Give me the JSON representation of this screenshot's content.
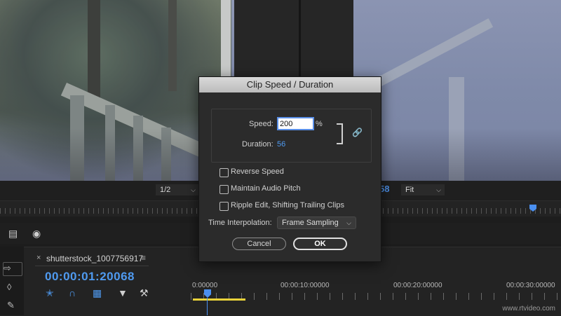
{
  "monitor": {
    "resolution": "1/2",
    "fit": "Fit",
    "timecode_partial": "58"
  },
  "sequence": {
    "tab_close": "×",
    "name": "shutterstock_1007756917",
    "menu_icon": "≡",
    "timecode": "00:00:01:20068",
    "ruler_labels": [
      "0:00000",
      "00:00:10:00000",
      "00:00:20:00000",
      "00:00:30:00000"
    ]
  },
  "dialog": {
    "title": "Clip Speed / Duration",
    "speed_label": "Speed:",
    "speed_value": "200",
    "speed_unit": "%",
    "duration_label": "Duration:",
    "duration_value": "56",
    "checkboxes": [
      {
        "label": "Reverse Speed",
        "checked": false
      },
      {
        "label": "Maintain Audio Pitch",
        "checked": false
      },
      {
        "label": "Ripple Edit, Shifting Trailing Clips",
        "checked": false
      }
    ],
    "interp_label": "Time Interpolation:",
    "interp_value": "Frame Sampling",
    "cancel_label": "Cancel",
    "ok_label": "OK"
  },
  "icons": {
    "chain": "link-icon",
    "camera": "camera-icon",
    "export_frame": "export-frame-icon"
  },
  "colors": {
    "accent": "#4f9af0",
    "playhead_range": "#e8d23a"
  },
  "watermark": "www.rtvideo.com"
}
